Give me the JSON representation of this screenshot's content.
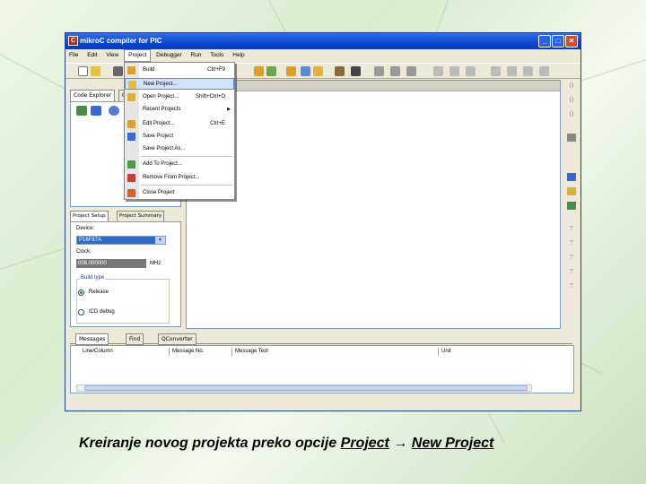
{
  "window": {
    "title": "mikroC compiler for PIC",
    "minimize": "_",
    "maximize": "□",
    "close": "✕"
  },
  "menubar": [
    "File",
    "Edit",
    "View",
    "Project",
    "Debugger",
    "Run",
    "Tools",
    "Help"
  ],
  "explorer": {
    "tab1": "Code Explorer",
    "tab2": "Q"
  },
  "project_menu": {
    "items": [
      {
        "label": "Build",
        "shortcut": "Ctrl+F9"
      },
      {
        "label": "New Project...",
        "shortcut": ""
      },
      {
        "label": "Open Project...",
        "shortcut": "Shift+Ctrl+O"
      },
      {
        "label": "Recent Projects",
        "shortcut": ""
      },
      {
        "label": "Edit Project...",
        "shortcut": "Ctrl+E"
      },
      {
        "label": "Save Project",
        "shortcut": ""
      },
      {
        "label": "Save Project As...",
        "shortcut": ""
      },
      {
        "label": "Add To Project...",
        "shortcut": ""
      },
      {
        "label": "Remove From Project...",
        "shortcut": ""
      },
      {
        "label": "Close Project",
        "shortcut": ""
      }
    ]
  },
  "project_settings": {
    "tab_setup": "Project Setup",
    "tab_summary": "Project Summary",
    "device_label": "Device:",
    "device_value": "P16F87A",
    "clock_label": "Clock:",
    "clock_value": "008.000000",
    "clock_unit": "MHz",
    "build_type_label": "Build type",
    "release": "Release",
    "icd_debug": "ICD debug"
  },
  "messages": {
    "tab_messages": "Messages",
    "tab_find": "Find",
    "tab_qconverter": "QConverter",
    "columns": [
      "Line/Column",
      "Message No.",
      "Message Text",
      "Unit"
    ]
  },
  "caption": {
    "prefix": "Kreiranje novog projekta preko opcije ",
    "project": "Project",
    "arrow": " → ",
    "new_project": "New Project"
  },
  "colors": {
    "titlebar": "#0a46cf",
    "menu_highlight": "#d2e2fb",
    "device_selected": "#316ac5"
  }
}
